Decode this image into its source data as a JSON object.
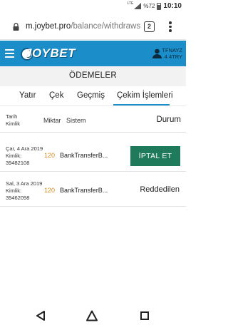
{
  "status_bar": {
    "network": "LTE",
    "battery": "%72",
    "time": "10:10"
  },
  "browser": {
    "url_domain": "m.joybet.pro",
    "url_path": "/balance/withdraws",
    "tab_count": "2"
  },
  "header": {
    "logo_text": "JOYBET",
    "username": "TFNAYZ",
    "balance": "4.4TRY",
    "brand_color": "#1b8ec9"
  },
  "page": {
    "title": "ÖDEMELER"
  },
  "tabs": [
    {
      "label": "Yatır"
    },
    {
      "label": "Çek"
    },
    {
      "label": "Geçmiş"
    },
    {
      "label": "Çekim İşlemleri",
      "active": true
    }
  ],
  "table": {
    "headers": {
      "date_line1": "Tarih",
      "date_line2": "Kimlik",
      "amount": "Miktar",
      "system": "Sistem",
      "status": "Durum"
    },
    "rows": [
      {
        "date": "Çar, 4 Ara 2019",
        "id_label": "Kimlik:",
        "id": "39482108",
        "amount": "120",
        "system": "BankTransferB...",
        "action_label": "İPTAL ET"
      },
      {
        "date": "Sal, 3 Ara 2019",
        "id_label": "Kimlik:",
        "id": "39462098",
        "amount": "120",
        "system": "BankTransferB...",
        "status": "Reddedilen"
      }
    ]
  },
  "nav": {
    "back_icon": "back-triangle-icon",
    "home_icon": "home-icon",
    "recent_icon": "recent-apps-icon"
  }
}
